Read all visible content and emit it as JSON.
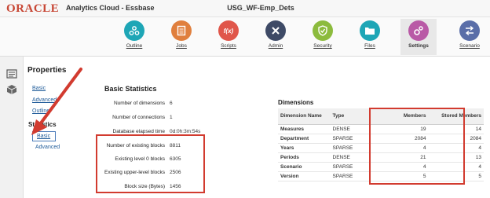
{
  "header": {
    "logo": "ORACLE",
    "app_title": "Analytics Cloud - Essbase",
    "db_title": "USG_WF-Emp_Dets"
  },
  "nav": [
    {
      "label": "Outline",
      "icon": "outline-icon",
      "glyph": "⚙",
      "color": "#1ea6b6"
    },
    {
      "label": "Jobs",
      "icon": "jobs-icon",
      "glyph": "▤",
      "color": "#e07f3d"
    },
    {
      "label": "Scripts",
      "icon": "scripts-icon",
      "glyph": "f(x)",
      "color": "#e0564a"
    },
    {
      "label": "Admin",
      "icon": "admin-icon",
      "glyph": "✕",
      "color": "#3e4a66"
    },
    {
      "label": "Security",
      "icon": "security-icon",
      "glyph": "✓",
      "color": "#8cbb3d"
    },
    {
      "label": "Files",
      "icon": "files-icon",
      "glyph": "▬",
      "color": "#1ea6b6"
    },
    {
      "label": "Settings",
      "icon": "settings-icon",
      "glyph": "⚙",
      "color": "#b95aa6",
      "active": true
    },
    {
      "label": "Scenario",
      "icon": "scenario-icon",
      "glyph": "⇄",
      "color": "#5a6ea8"
    }
  ],
  "properties": {
    "title": "Properties",
    "links": [
      "Basic",
      "Advanced",
      "Outline"
    ],
    "statistics_title": "Statistics",
    "statistics_links": [
      "Basic",
      "Advanced"
    ]
  },
  "basic_stats": {
    "title": "Basic Statistics",
    "rows": [
      {
        "label": "Number of dimensions",
        "value": "6"
      },
      {
        "label": "Number of connections",
        "value": "1"
      },
      {
        "label": "Database elapsed time",
        "value": "0d:0h:3m:54s"
      },
      {
        "label": "Number of existing blocks",
        "value": "8811"
      },
      {
        "label": "Existing level 0 blocks",
        "value": "6305"
      },
      {
        "label": "Existing upper-level blocks",
        "value": "2506"
      },
      {
        "label": "Block size (Bytes)",
        "value": "1456"
      }
    ]
  },
  "dimensions": {
    "title": "Dimensions",
    "headers": {
      "name": "Dimension Name",
      "type": "Type",
      "members": "Members",
      "stored": "Stored Members"
    },
    "rows": [
      {
        "name": "Measures",
        "type": "DENSE",
        "members": "19",
        "stored": "14"
      },
      {
        "name": "Department",
        "type": "SPARSE",
        "members": "2084",
        "stored": "2084"
      },
      {
        "name": "Years",
        "type": "SPARSE",
        "members": "4",
        "stored": "4"
      },
      {
        "name": "Periods",
        "type": "DENSE",
        "members": "21",
        "stored": "13"
      },
      {
        "name": "Scenario",
        "type": "SPARSE",
        "members": "4",
        "stored": "4"
      },
      {
        "name": "Version",
        "type": "SPARSE",
        "members": "5",
        "stored": "5"
      }
    ]
  },
  "colors": {
    "highlight": "#d23b2f",
    "link": "#1f5b99"
  }
}
